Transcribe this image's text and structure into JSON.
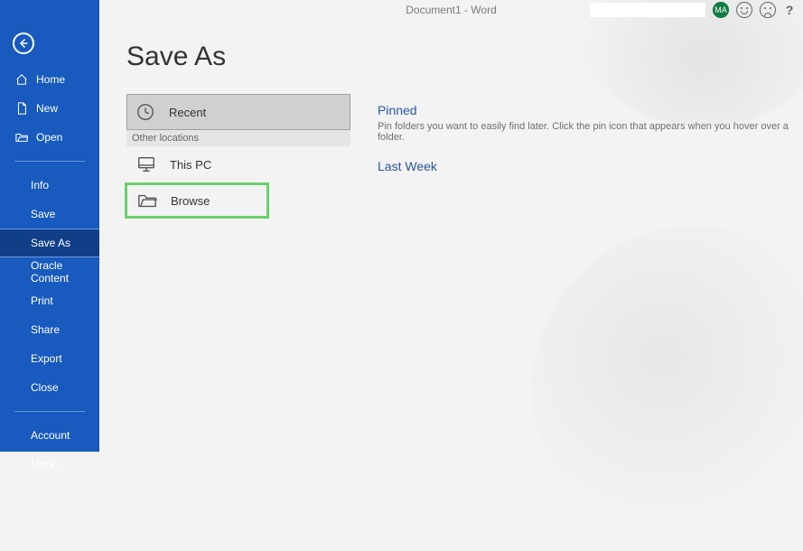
{
  "topbar": {
    "doc_title": "Document1  -  Word",
    "avatar_initials": "MA",
    "help": "?"
  },
  "sidebar": {
    "home": "Home",
    "new": "New",
    "open": "Open",
    "info": "Info",
    "save": "Save",
    "save_as": "Save As",
    "oracle": "Oracle Content",
    "print": "Print",
    "share": "Share",
    "export": "Export",
    "close": "Close",
    "account": "Account",
    "more": "More..."
  },
  "page": {
    "title": "Save As"
  },
  "locations": {
    "recent": "Recent",
    "other_header": "Other locations",
    "this_pc": "This PC",
    "browse": "Browse"
  },
  "right": {
    "pinned_title": "Pinned",
    "pinned_text": "Pin folders you want to easily find later. Click the pin icon that appears when you hover over a folder.",
    "lastweek_title": "Last Week"
  }
}
